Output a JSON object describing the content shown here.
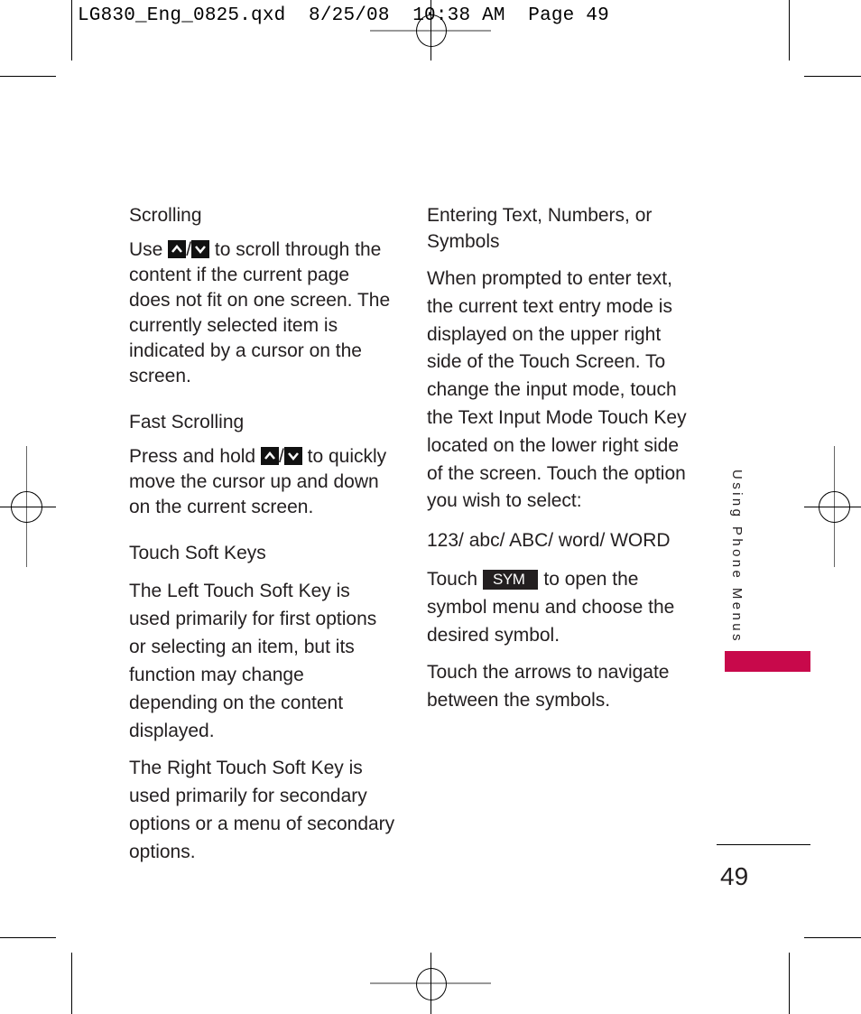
{
  "slug": "LG830_Eng_0825.qxd  8/25/08  10:38 AM  Page 49",
  "left_column": {
    "scrolling": {
      "heading": "Scrolling",
      "line1_pre": "Use ",
      "line1_post": " to scroll through the",
      "rest": "content if the current page does not fit on one screen. The currently selected item is indicated by a cursor on the screen."
    },
    "fast_scrolling": {
      "heading": "Fast Scrolling",
      "line1_pre": "Press and hold ",
      "line1_post": " to quickly",
      "rest": "move the cursor up and down on the current screen."
    },
    "touch_soft_keys": {
      "heading": "Touch Soft Keys",
      "para1": "The Left Touch Soft Key is used primarily for first options or selecting an item, but its function may change depending on the content displayed.",
      "para2": "The Right Touch Soft Key is used primarily for secondary options or a menu of secondary options."
    },
    "slash": "/"
  },
  "right_column": {
    "heading_line1": "Entering Text, Numbers, or",
    "heading_line2": "Symbols",
    "para1": "When prompted to enter text, the current text entry mode is displayed on the upper right side of the Touch Screen. To change the input mode, touch the Text Input Mode Touch Key located on the lower right side of the screen. Touch the option you wish to select:",
    "modes": "123/ abc/ ABC/ word/ WORD",
    "para2_pre": "Touch",
    "sym_key": "SYM",
    "para2_post": "to open the symbol menu and choose the desired symbol.",
    "para3": "Touch the arrows to navigate between the symbols."
  },
  "side_tab": {
    "label": "Using Phone Menus",
    "color": "#c8094b"
  },
  "page_number": "49"
}
